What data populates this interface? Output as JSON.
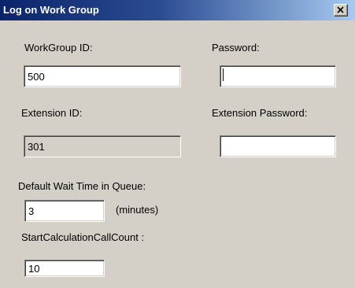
{
  "window": {
    "title": "Log on Work Group",
    "close_glyph": "close-icon"
  },
  "form": {
    "workgroup_id_label": "WorkGroup ID:",
    "workgroup_id_value": "500",
    "password_label": "Password:",
    "password_value": "",
    "extension_id_label": "Extension ID:",
    "extension_id_value": "301",
    "extension_password_label": "Extension Password:",
    "extension_password_value": "",
    "wait_time_label": "Default Wait Time in Queue:",
    "wait_time_value": "3",
    "wait_time_unit": "(minutes)",
    "call_count_label": "StartCalculationCallCount :",
    "call_count_value": "10"
  }
}
